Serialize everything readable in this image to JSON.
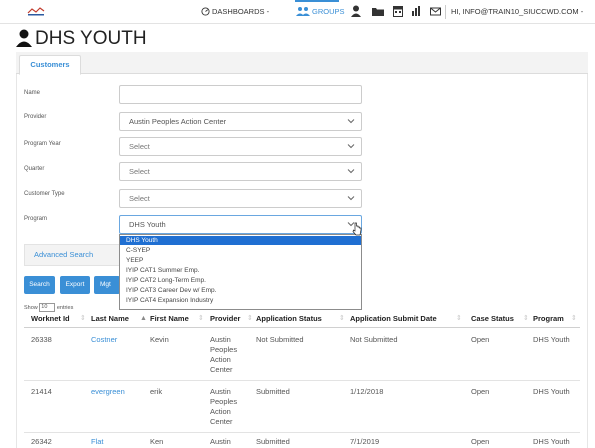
{
  "nav": {
    "dashboards": "DASHBOARDS -",
    "groups": "GROUPS",
    "user": "HI, INFO@TRAIN10_SIUCCWD.COM -"
  },
  "title": "DHS YOUTH",
  "tab": "Customers",
  "form": {
    "name_label": "Name",
    "name_value": "",
    "provider_label": "Provider",
    "provider_value": "Austin Peoples Action Center",
    "program_year_label": "Program Year",
    "program_year_value": "Select",
    "quarter_label": "Quarter",
    "quarter_value": "Select",
    "customer_type_label": "Customer Type",
    "customer_type_value": "Select",
    "program_label": "Program",
    "program_value": "DHS Youth"
  },
  "program_options": [
    "DHS Youth",
    "C-SYEP",
    "YEEP",
    "IYIP CAT1 Summer Emp.",
    "IYIP CAT2 Long-Term Emp.",
    "IYIP CAT3 Career Dev w/ Emp.",
    "IYIP CAT4 Expansion Industry"
  ],
  "advanced_search": "Advanced Search",
  "buttons": {
    "search": "Search",
    "export": "Export",
    "mgt": "Mgt"
  },
  "show_entries": {
    "prefix": "Show",
    "value": "10",
    "suffix": "entries"
  },
  "table": {
    "headers": [
      "Worknet Id",
      "Last Name",
      "First Name",
      "Provider",
      "Application Status",
      "Application Submit Date",
      "Case Status",
      "Program"
    ],
    "rows": [
      {
        "id": "26338",
        "last": "Costner",
        "first": "Kevin",
        "provider": [
          "Austin",
          "Peoples",
          "Action",
          "Center"
        ],
        "status": "Not Submitted",
        "date": "Not Submitted",
        "case": "Open",
        "program": "DHS Youth"
      },
      {
        "id": "21414",
        "last": "evergreen",
        "first": "erik",
        "provider": [
          "Austin",
          "Peoples",
          "Action",
          "Center"
        ],
        "status": "Submitted",
        "date": "1/12/2018",
        "case": "Open",
        "program": "DHS Youth"
      },
      {
        "id": "26342",
        "last": "Flat",
        "first": "Ken",
        "provider": [
          "Austin"
        ],
        "status": "Submitted",
        "date": "7/1/2019",
        "case": "Open",
        "program": "DHS Youth"
      }
    ]
  },
  "colors": {
    "accent": "#3a8fd6",
    "selected_option": "#1f6fd2"
  }
}
